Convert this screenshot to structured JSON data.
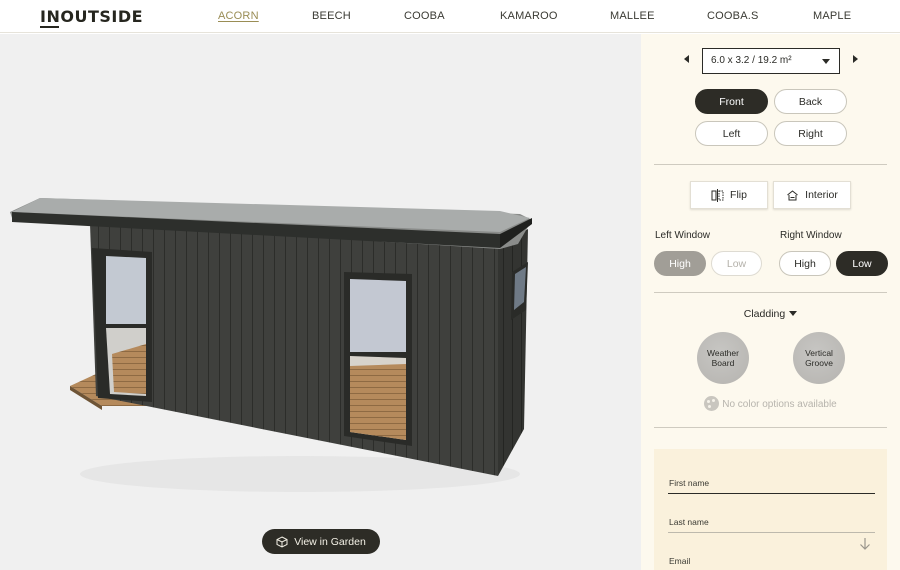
{
  "header": {
    "logo": "INOUTSIDE",
    "nav": [
      {
        "label": "ACORN",
        "active": true
      },
      {
        "label": "BEECH",
        "active": false
      },
      {
        "label": "COOBA",
        "active": false
      },
      {
        "label": "KAMAROO",
        "active": false
      },
      {
        "label": "MALLEE",
        "active": false
      },
      {
        "label": "COOBA.S",
        "active": false
      },
      {
        "label": "MAPLE",
        "active": false
      }
    ]
  },
  "viewer": {
    "view_in_garden": "View in Garden"
  },
  "panel": {
    "size_select": "6.0 x 3.2 / 19.2 m²",
    "views": {
      "front": "Front",
      "back": "Back",
      "left": "Left",
      "right": "Right",
      "selected": "Front"
    },
    "flip": "Flip",
    "interior": "Interior",
    "left_window": {
      "label": "Left Window",
      "high": "High",
      "low": "Low",
      "selected": "High"
    },
    "right_window": {
      "label": "Right Window",
      "high": "High",
      "low": "Low",
      "selected": "Low"
    },
    "cladding": {
      "label": "Cladding",
      "options": [
        {
          "line1": "Weather",
          "line2": "Board"
        },
        {
          "line1": "Vertical",
          "line2": "Groove"
        }
      ],
      "no_color": "No color options available"
    },
    "form": {
      "first_name": "First name",
      "last_name": "Last name",
      "email": "Email"
    }
  },
  "colors": {
    "accent_gold": "#9a8d55",
    "dark": "#2d2c26",
    "panel_bg": "#fdf9ee",
    "form_bg": "#faf1dc"
  }
}
